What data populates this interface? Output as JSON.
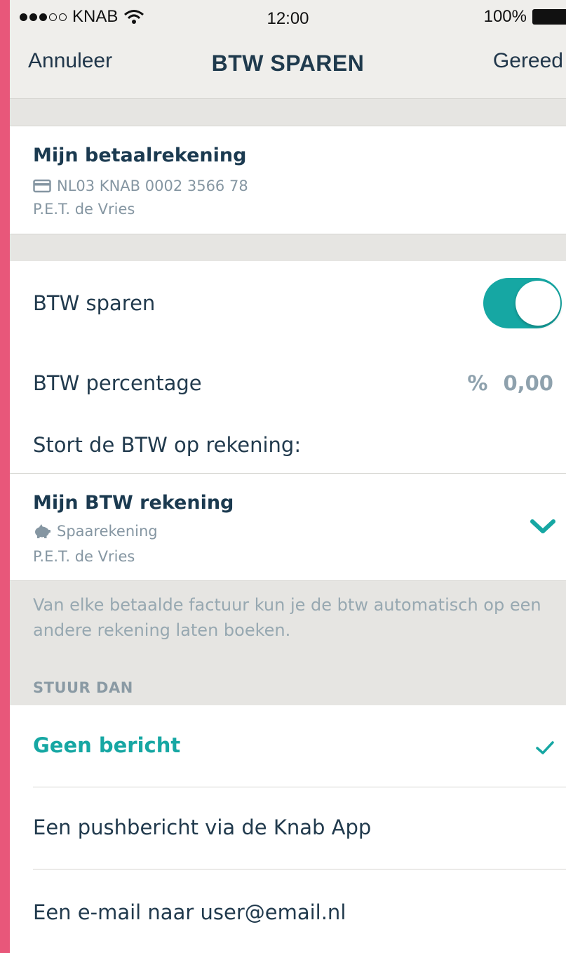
{
  "status_bar": {
    "carrier": "KNAB",
    "time": "12:00",
    "battery": "100%",
    "signal_bars_filled": 3,
    "signal_bars_total": 5
  },
  "nav": {
    "cancel_label": "Annuleer",
    "title": "BTW SPAREN",
    "done_label": "Gereed"
  },
  "source_account": {
    "title": "Mijn betaalrekening",
    "iban": "NL03 KNAB 0002 3566 78",
    "owner": "P.E.T. de Vries",
    "icon": "card-icon"
  },
  "settings": {
    "btw_saving_label": "BTW sparen",
    "btw_saving_enabled": true,
    "btw_percentage_label": "BTW percentage",
    "btw_percentage_symbol": "%",
    "btw_percentage_value": "0,00",
    "deposit_label": "Stort de BTW op rekening:"
  },
  "target_account": {
    "title": "Mijn BTW rekening",
    "type": "Spaarekening",
    "owner": "P.E.T. de Vries",
    "icon": "piggy-bank-icon"
  },
  "info_text": "Van elke betaalde factuur kun je de btw automatisch op een andere rekening laten boeken.",
  "notify": {
    "header": "STUUR DAN",
    "options": [
      {
        "label": "Geen bericht",
        "selected": true
      },
      {
        "label": "Een pushbericht via de Knab App",
        "selected": false
      },
      {
        "label": "Een e-mail naar user@email.nl",
        "selected": false
      }
    ]
  },
  "colors": {
    "accent": "#16a7a3",
    "brand_navy": "#1f3a4d",
    "left_edge": "#e8577a"
  }
}
